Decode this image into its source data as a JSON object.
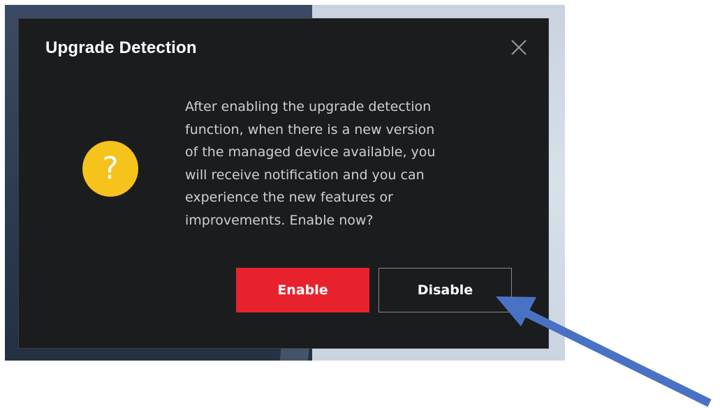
{
  "dialog": {
    "title": "Upgrade Detection",
    "close_icon": "close-icon",
    "status_icon": "question-icon",
    "status_icon_glyph": "?",
    "status_icon_color": "#f6c21c",
    "message": "After enabling the upgrade detection\nfunction, when there is a new version\nof the managed device available, you\nwill receive notification and you can\nexperience the new features or\nimprovements. Enable now?",
    "buttons": {
      "enable_label": "Enable",
      "disable_label": "Disable"
    },
    "colors": {
      "background": "#1b1c1e",
      "enable_button": "#e8222d",
      "title_text": "#ffffff"
    }
  },
  "annotation": {
    "arrow_icon": "pointer-arrow",
    "arrow_color": "#4a72c4"
  }
}
